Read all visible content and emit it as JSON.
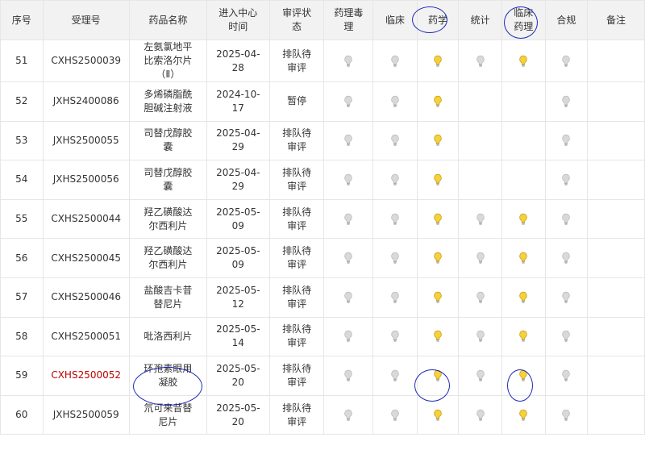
{
  "headers": [
    "序号",
    "受理号",
    "药品名称",
    "进入中心时间",
    "审评状态",
    "药理毒理",
    "临床",
    "药学",
    "统计",
    "临床药理",
    "合规",
    "备注"
  ],
  "header_parts": {
    "center_time": [
      "进入中心",
      "时间"
    ],
    "review_status": [
      "审评状",
      "态"
    ],
    "pharm_tox": [
      "药理毒",
      "理"
    ],
    "clin_pharm": [
      "临床",
      "药理"
    ]
  },
  "colors": {
    "bulb_on": "#f5d13c",
    "bulb_off": "#d9d9d9",
    "highlight_id": "#c00000",
    "annotation": "#1e2ab8"
  },
  "rows": [
    {
      "no": "51",
      "id": "CXHS2500039",
      "name": [
        "左氨氯地平",
        "比索洛尔片",
        "（Ⅱ）"
      ],
      "date": [
        "2025-04-",
        "28"
      ],
      "status": [
        "排队待",
        "审评"
      ],
      "lights": [
        "off",
        "off",
        "on",
        "off",
        "on",
        "off"
      ],
      "highlight": false
    },
    {
      "no": "52",
      "id": "JXHS2400086",
      "name": [
        "多烯磷脂酰",
        "胆碱注射液"
      ],
      "date": [
        "2024-10-",
        "17"
      ],
      "status": [
        "暂停"
      ],
      "lights": [
        "off",
        "off",
        "on",
        "",
        "",
        "off"
      ],
      "highlight": false
    },
    {
      "no": "53",
      "id": "JXHS2500055",
      "name": [
        "司替戊醇胶",
        "囊"
      ],
      "date": [
        "2025-04-",
        "29"
      ],
      "status": [
        "排队待",
        "审评"
      ],
      "lights": [
        "off",
        "off",
        "on",
        "",
        "",
        "off"
      ],
      "highlight": false
    },
    {
      "no": "54",
      "id": "JXHS2500056",
      "name": [
        "司替戊醇胶",
        "囊"
      ],
      "date": [
        "2025-04-",
        "29"
      ],
      "status": [
        "排队待",
        "审评"
      ],
      "lights": [
        "off",
        "off",
        "on",
        "",
        "",
        "off"
      ],
      "highlight": false
    },
    {
      "no": "55",
      "id": "CXHS2500044",
      "name": [
        "羟乙磺酸达",
        "尔西利片"
      ],
      "date": [
        "2025-05-",
        "09"
      ],
      "status": [
        "排队待",
        "审评"
      ],
      "lights": [
        "off",
        "off",
        "on",
        "off",
        "on",
        "off"
      ],
      "highlight": false
    },
    {
      "no": "56",
      "id": "CXHS2500045",
      "name": [
        "羟乙磺酸达",
        "尔西利片"
      ],
      "date": [
        "2025-05-",
        "09"
      ],
      "status": [
        "排队待",
        "审评"
      ],
      "lights": [
        "off",
        "off",
        "on",
        "off",
        "on",
        "off"
      ],
      "highlight": false
    },
    {
      "no": "57",
      "id": "CXHS2500046",
      "name": [
        "盐酸吉卡昔",
        "替尼片"
      ],
      "date": [
        "2025-05-",
        "12"
      ],
      "status": [
        "排队待",
        "审评"
      ],
      "lights": [
        "off",
        "off",
        "on",
        "off",
        "on",
        "off"
      ],
      "highlight": false
    },
    {
      "no": "58",
      "id": "CXHS2500051",
      "name": [
        "吡洛西利片"
      ],
      "date": [
        "2025-05-",
        "14"
      ],
      "status": [
        "排队待",
        "审评"
      ],
      "lights": [
        "off",
        "off",
        "on",
        "off",
        "on",
        "off"
      ],
      "highlight": false
    },
    {
      "no": "59",
      "id": "CXHS2500052",
      "name": [
        "环孢素眼用",
        "凝胶"
      ],
      "date": [
        "2025-05-",
        "20"
      ],
      "status": [
        "排队待",
        "审评"
      ],
      "lights": [
        "off",
        "off",
        "on",
        "off",
        "on",
        "off"
      ],
      "highlight": true
    },
    {
      "no": "60",
      "id": "JXHS2500059",
      "name": [
        "氘可来昔替",
        "尼片"
      ],
      "date": [
        "2025-05-",
        "20"
      ],
      "status": [
        "排队待",
        "审评"
      ],
      "lights": [
        "off",
        "off",
        "on",
        "off",
        "on",
        "off"
      ],
      "highlight": false
    }
  ]
}
